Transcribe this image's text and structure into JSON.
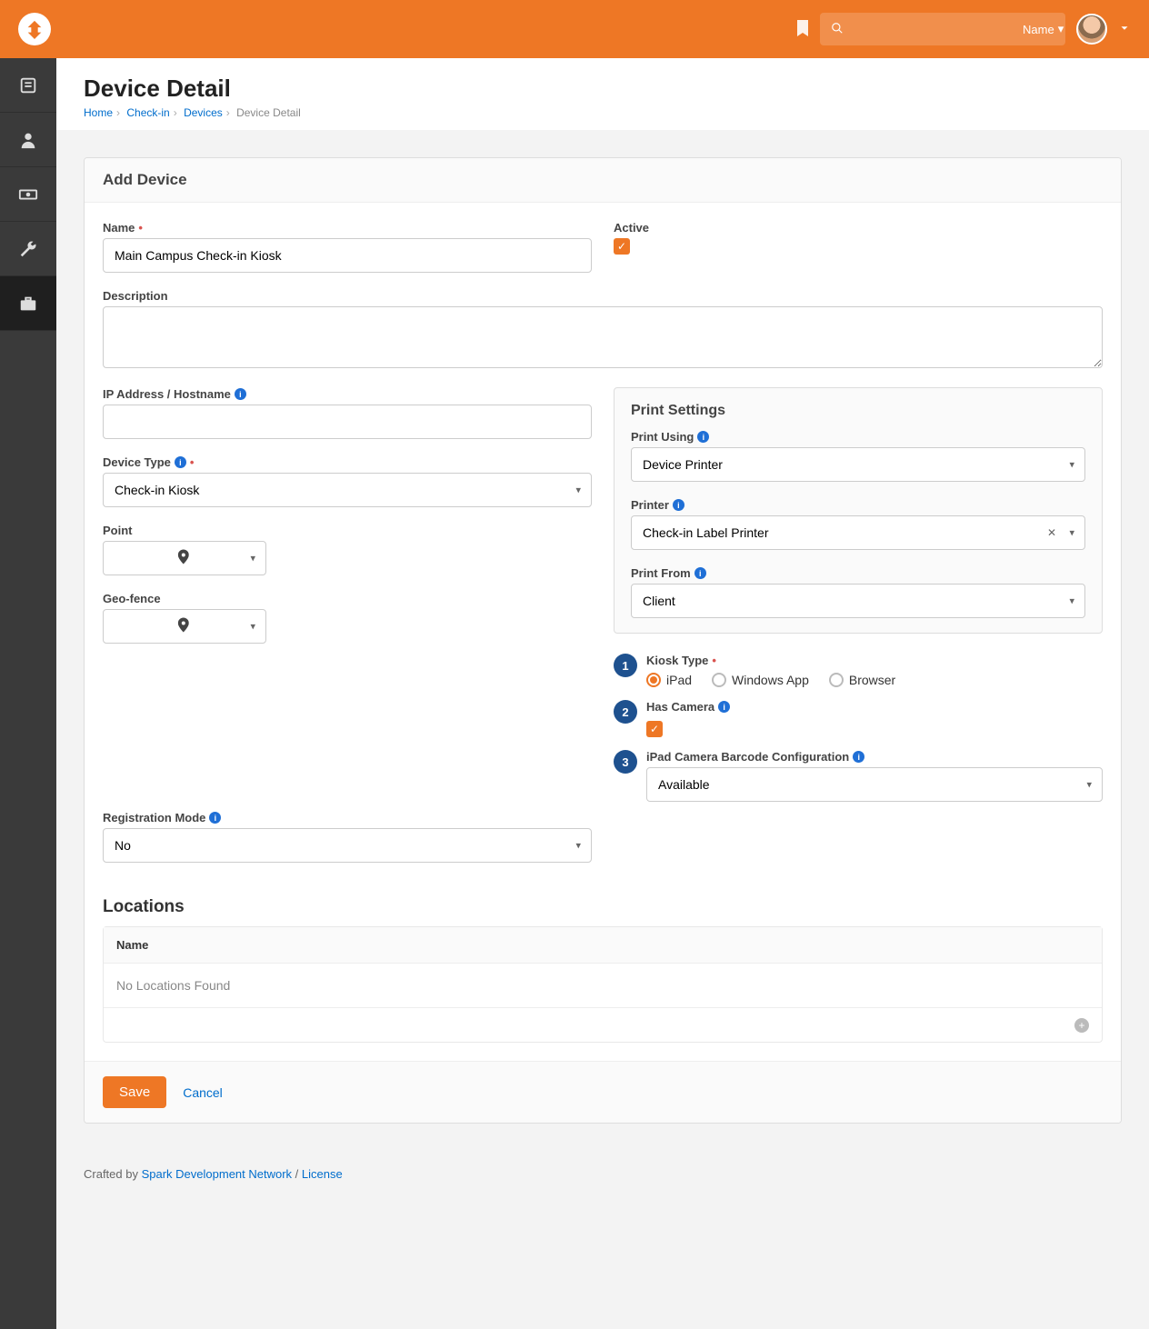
{
  "header": {
    "name_label": "Name"
  },
  "page": {
    "title": "Device Detail",
    "breadcrumb": [
      "Home",
      "Check-in",
      "Devices",
      "Device Detail"
    ]
  },
  "panel": {
    "title": "Add Device",
    "fields": {
      "name_label": "Name",
      "name_value": "Main Campus Check-in Kiosk",
      "active_label": "Active",
      "active_checked": true,
      "description_label": "Description",
      "description_value": "",
      "ip_label": "IP Address / Hostname",
      "ip_value": "",
      "device_type_label": "Device Type",
      "device_type_value": "Check-in Kiosk",
      "point_label": "Point",
      "geofence_label": "Geo-fence",
      "registration_mode_label": "Registration Mode",
      "registration_mode_value": "No"
    },
    "print": {
      "title": "Print Settings",
      "print_using_label": "Print Using",
      "print_using_value": "Device Printer",
      "printer_label": "Printer",
      "printer_value": "Check-in Label Printer",
      "print_from_label": "Print From",
      "print_from_value": "Client"
    },
    "kiosk": {
      "kiosk_type_label": "Kiosk Type",
      "options": {
        "ipad": "iPad",
        "windows": "Windows App",
        "browser": "Browser"
      },
      "selected": "ipad",
      "has_camera_label": "Has Camera",
      "has_camera_checked": true,
      "barcode_label": "iPad Camera Barcode Configuration",
      "barcode_value": "Available"
    },
    "callouts": {
      "one": "1",
      "two": "2",
      "three": "3"
    },
    "locations": {
      "title": "Locations",
      "col_name": "Name",
      "empty": "No Locations Found"
    },
    "actions": {
      "save": "Save",
      "cancel": "Cancel"
    }
  },
  "footer": {
    "prefix": "Crafted by ",
    "link1": "Spark Development Network",
    "sep": " / ",
    "link2": "License"
  }
}
